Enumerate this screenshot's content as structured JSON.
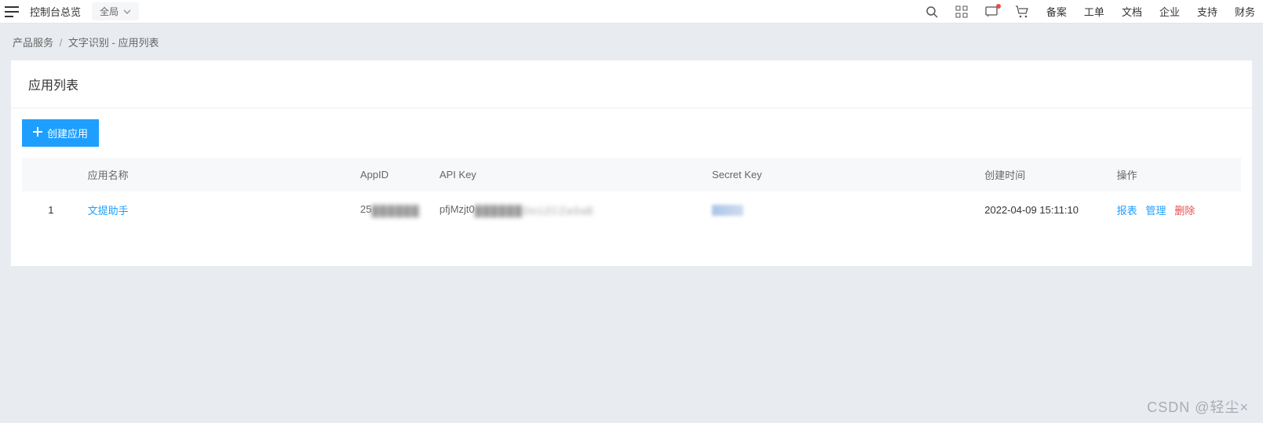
{
  "topbar": {
    "console_title": "控制台总览",
    "region_label": "全局",
    "text_links": [
      "备案",
      "工单",
      "文档",
      "企业",
      "支持",
      "财务"
    ]
  },
  "breadcrumb": {
    "items": [
      "产品服务",
      "文字识别 - 应用列表"
    ],
    "sep": "/"
  },
  "panel": {
    "title": "应用列表",
    "create_btn_label": "创建应用"
  },
  "table": {
    "headers": {
      "index": "",
      "name": "应用名称",
      "appid": "AppID",
      "apikey": "API Key",
      "secret": "Secret Key",
      "time": "创建时间",
      "action": "操作"
    },
    "rows": [
      {
        "index": "1",
        "name": "文提助手",
        "appid_prefix": "25",
        "apikey_prefix": "pfjMzjt0",
        "apikey_mid_hint": "Oo1ZCZaSaE",
        "time": "2022-04-09 15:11:10",
        "actions": {
          "report": "报表",
          "manage": "管理",
          "delete": "删除"
        }
      }
    ]
  },
  "watermark": "CSDN @轻尘×"
}
